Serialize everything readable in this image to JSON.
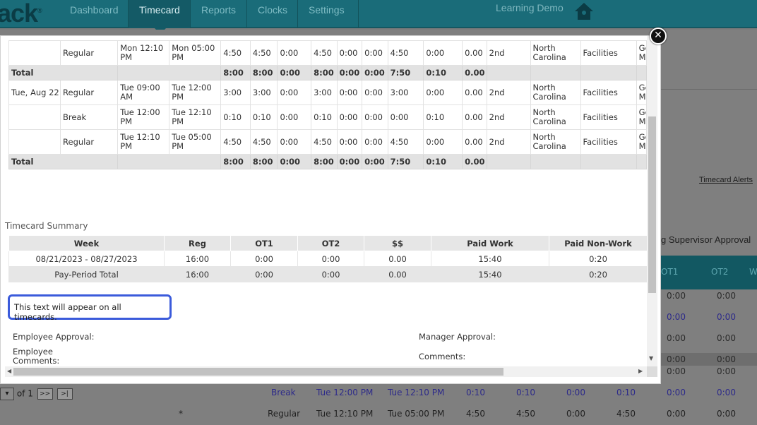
{
  "app": {
    "logo_text": "ack",
    "logo_mark": "®",
    "company": "Learning Demo"
  },
  "nav": {
    "tabs": [
      {
        "label": "Dashboard"
      },
      {
        "label": "Timecard"
      },
      {
        "label": "Reports"
      },
      {
        "label": "Clocks"
      },
      {
        "label": "Settings"
      }
    ],
    "active": "Timecard"
  },
  "background": {
    "alerts_link": "Timecard Alerts",
    "approval_header": "g Supervisor Approval",
    "col_ot1": "OT1",
    "col_ot2": "OT2",
    "col_w": "W",
    "right_values": [
      [
        "0:00",
        "0:00"
      ],
      [
        "0:00",
        "0:00"
      ],
      [
        "0:00",
        "0:00"
      ],
      [
        "0:00",
        "0:00"
      ],
      [
        "0:00",
        "0:00"
      ]
    ],
    "pager": {
      "of_text": "of 1",
      "next": ">>",
      "last": ">|"
    },
    "rows": [
      {
        "type": "Break",
        "start": "Tue 12:00 PM",
        "end": "Tue 12:10 PM",
        "c1": "0:10",
        "c2": "0:10",
        "c3": "0:00",
        "c4": "0:10",
        "c5": "0:00",
        "c6": "0:00"
      },
      {
        "mark": "*",
        "type": "Regular",
        "start": "Tue 12:10 PM",
        "end": "Tue 05:00 PM",
        "c1": "4:50",
        "c2": "4:50",
        "c3": "0:00",
        "c4": "4:50",
        "c5": "0:00",
        "c6": "0:00"
      }
    ]
  },
  "detail_rows": [
    {
      "kind": "row",
      "date": "",
      "type": "Regular",
      "start": "Mon 12:10 PM",
      "end": "Mon 05:00 PM",
      "v": [
        "4:50",
        "4:50",
        "0:00",
        "4:50",
        "0:00",
        "0:00",
        "4:50",
        "0:00",
        "0.00"
      ],
      "shift": "2nd",
      "location": "North Carolina",
      "dept": "Facilities",
      "extra": "Ge M"
    },
    {
      "kind": "total",
      "label": "Total",
      "v": [
        "8:00",
        "8:00",
        "0:00",
        "8:00",
        "0:00",
        "0:00",
        "7:50",
        "0:10",
        "0.00"
      ]
    },
    {
      "kind": "row",
      "date": "Tue, Aug 22",
      "type": "Regular",
      "start": "Tue 09:00 AM",
      "end": "Tue 12:00 PM",
      "v": [
        "3:00",
        "3:00",
        "0:00",
        "3:00",
        "0:00",
        "0:00",
        "3:00",
        "0:00",
        "0.00"
      ],
      "shift": "2nd",
      "location": "North Carolina",
      "dept": "Facilities",
      "extra": "Ge M"
    },
    {
      "kind": "row",
      "date": "",
      "type": "Break",
      "start": "Tue 12:00 PM",
      "end": "Tue 12:10 PM",
      "v": [
        "0:10",
        "0:10",
        "0:00",
        "0:10",
        "0:00",
        "0:00",
        "0:00",
        "0:10",
        "0.00"
      ],
      "shift": "2nd",
      "location": "North Carolina",
      "dept": "Facilities",
      "extra": "Ge M"
    },
    {
      "kind": "row",
      "date": "",
      "type": "Regular",
      "start": "Tue 12:10 PM",
      "end": "Tue 05:00 PM",
      "v": [
        "4:50",
        "4:50",
        "0:00",
        "4:50",
        "0:00",
        "0:00",
        "4:50",
        "0:00",
        "0.00"
      ],
      "shift": "2nd",
      "location": "North Carolina",
      "dept": "Facilities",
      "extra": "Ge M"
    },
    {
      "kind": "total",
      "label": "Total",
      "v": [
        "8:00",
        "8:00",
        "0:00",
        "8:00",
        "0:00",
        "0:00",
        "7:50",
        "0:10",
        "0.00"
      ]
    }
  ],
  "summary": {
    "title": "Timecard Summary",
    "headers": [
      "Week",
      "Reg",
      "OT1",
      "OT2",
      "$$",
      "Paid Work",
      "Paid Non-Work"
    ],
    "rows": [
      [
        "08/21/2023 - 08/27/2023",
        "16:00",
        "0:00",
        "0:00",
        "0.00",
        "15:40",
        "0:20"
      ],
      [
        "Pay-Period Total",
        "16:00",
        "0:00",
        "0:00",
        "0.00",
        "15:40",
        "0:20"
      ]
    ]
  },
  "note_text": "This text will appear on all timecards.",
  "approvals": {
    "employee_approval": "Employee Approval:",
    "employee_comments": "Employee Comments:",
    "manager_approval": "Manager Approval:",
    "comments": "Comments:"
  },
  "colors": {
    "nav_bg": "#1a6c79",
    "note_border": "#3b5bdb",
    "total_row": "#e2e2e2"
  }
}
